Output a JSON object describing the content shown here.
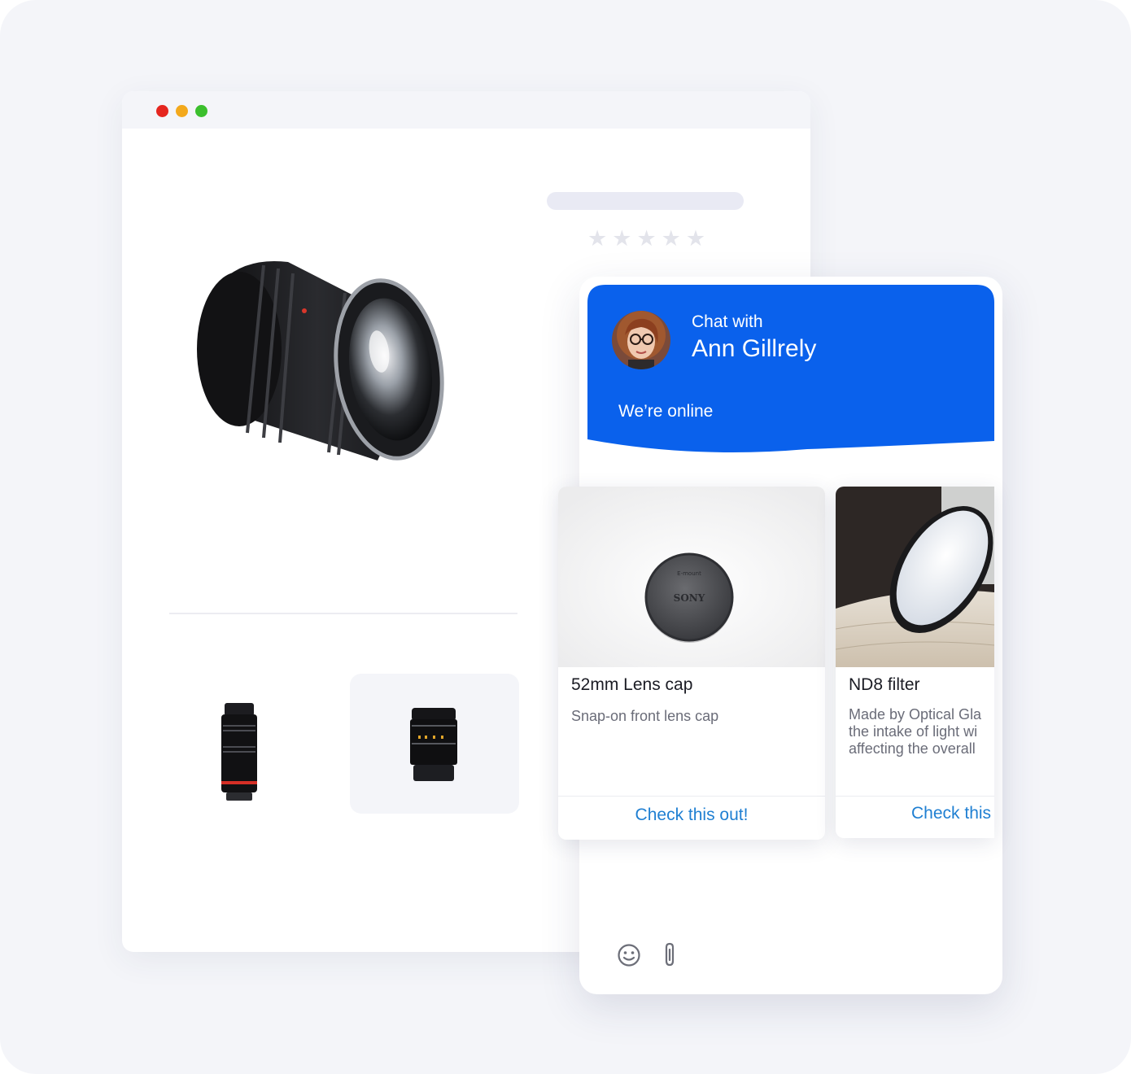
{
  "browser": {
    "traffic_lights": {
      "close_color": "#e5261f",
      "minimize_color": "#f3a91c",
      "maximize_color": "#3bbf2d"
    },
    "product": {
      "rating_stars": 5,
      "main_image": "camera-lens",
      "thumbnails": [
        "zoom-lens",
        "prime-lens"
      ]
    }
  },
  "chat": {
    "accent_color": "#0a61ec",
    "header": {
      "chat_with_label": "Chat with",
      "agent_name": "Ann Gillrely",
      "status_text": "We’re online"
    },
    "cards": [
      {
        "title": "52mm Lens cap",
        "description": "Snap-on front lens cap",
        "button_label": "Check this out!",
        "image_brand_text": "SONY",
        "image_small_text": "E-mount"
      },
      {
        "title": "ND8 filter",
        "description_lines": [
          "Made by Optical Gla",
          "the intake of light wi",
          "affecting the overall"
        ],
        "button_label": "Check this"
      }
    ],
    "composer_icons": [
      "emoji-icon",
      "attachment-icon"
    ]
  }
}
